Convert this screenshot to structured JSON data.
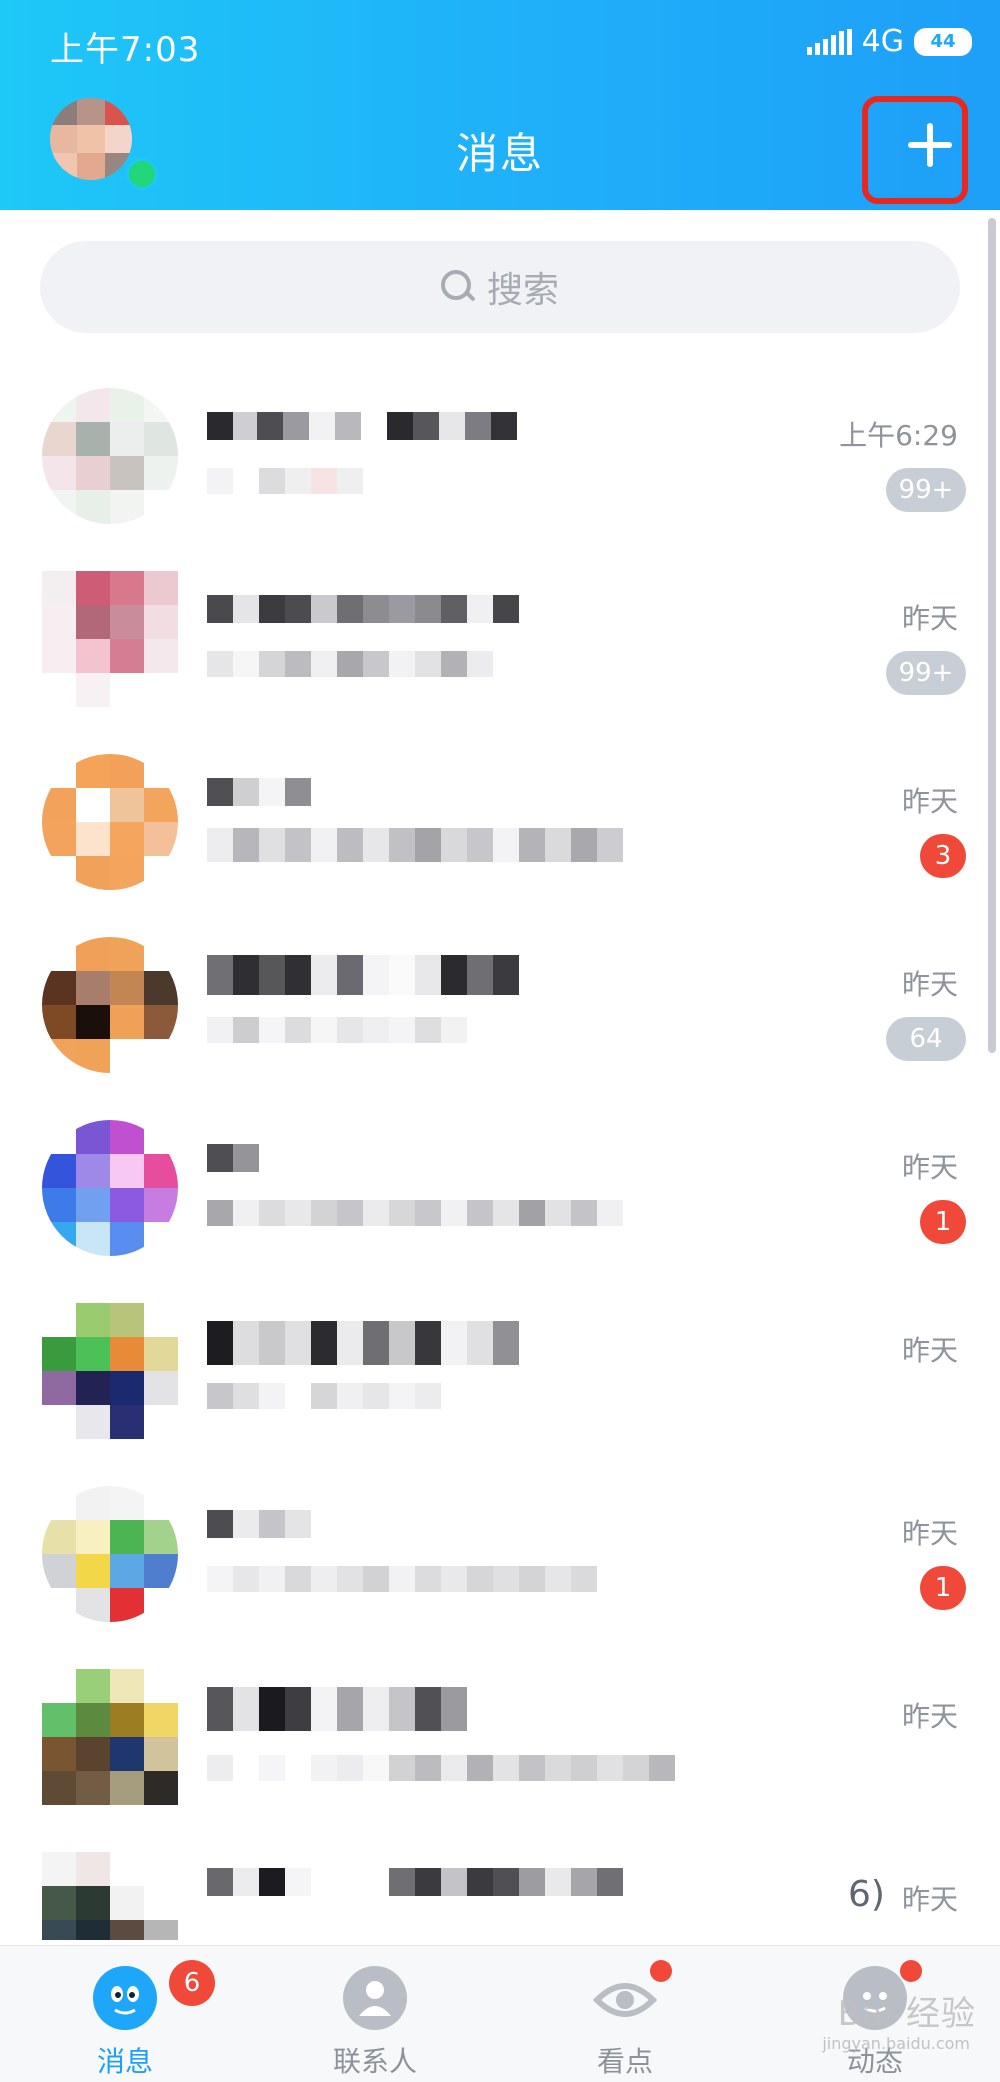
{
  "status_bar": {
    "time": "上午7:03",
    "network": "4G",
    "battery": "44"
  },
  "header": {
    "title": "消息"
  },
  "search": {
    "placeholder": "搜索"
  },
  "conversations": [
    {
      "time": "上午6:29",
      "badge": "99+",
      "badge_style": "grey"
    },
    {
      "time": "昨天",
      "badge": "99+",
      "badge_style": "grey"
    },
    {
      "time": "昨天",
      "badge": "3",
      "badge_style": "red"
    },
    {
      "time": "昨天",
      "badge": "64",
      "badge_style": "grey"
    },
    {
      "time": "昨天",
      "badge": "1",
      "badge_style": "red"
    },
    {
      "time": "昨天",
      "badge": "",
      "badge_style": "none"
    },
    {
      "time": "昨天",
      "badge": "1",
      "badge_style": "red"
    },
    {
      "time": "昨天",
      "badge": "",
      "badge_style": "none"
    },
    {
      "time": "昨天",
      "badge": "",
      "badge_style": "none",
      "extra": "6)"
    }
  ],
  "bottom_nav": [
    {
      "label": "消息",
      "badge": "6",
      "icon": "qq-penguin-icon",
      "active": true
    },
    {
      "label": "联系人",
      "icon": "contact-person-icon",
      "active": false
    },
    {
      "label": "看点",
      "icon": "eye-icon",
      "active": false,
      "dot": true
    },
    {
      "label": "动态",
      "icon": "star-face-icon",
      "active": false,
      "dot": true
    }
  ],
  "watermark": {
    "text": "Bai 经验",
    "sub": "jingyan.baidu.com"
  },
  "colors": {
    "header_start": "#1ec8f7",
    "header_end": "#1e9ff8",
    "highlight_border": "#e8281e",
    "badge_red": "#f0493a",
    "badge_grey": "#c8ced6",
    "online_green": "#21d77a"
  }
}
